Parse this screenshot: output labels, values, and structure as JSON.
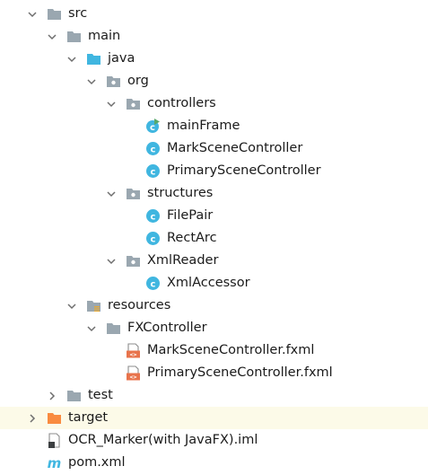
{
  "tree": {
    "src": "src",
    "main": "main",
    "java": "java",
    "org": "org",
    "controllers": "controllers",
    "mainFrame": "mainFrame",
    "markSceneController": "MarkSceneController",
    "primarySceneController": "PrimarySceneController",
    "structures": "structures",
    "filePair": "FilePair",
    "rectArc": "RectArc",
    "xmlReader": "XmlReader",
    "xmlAccessor": "XmlAccessor",
    "resources": "resources",
    "fxController": "FXController",
    "markSceneFxml": "MarkSceneController.fxml",
    "primarySceneFxml": "PrimarySceneController.fxml",
    "test": "test",
    "target": "target",
    "imlFile": "OCR_Marker(with JavaFX).iml",
    "pomFile": "pom.xml"
  },
  "colors": {
    "folder": "#9aa7b0",
    "sourceFolder": "#40b6e0",
    "excludedFolder": "#f98b3f",
    "classIcon": "#40b6e0",
    "highlight": "#fcfae8"
  },
  "icons": {
    "expanded": "chevron-down-icon",
    "collapsed": "chevron-right-icon",
    "folder": "folder-icon",
    "package": "package-icon",
    "class": "class-icon",
    "fxml": "fxml-file-icon",
    "module": "module-file-icon",
    "maven": "maven-icon"
  }
}
